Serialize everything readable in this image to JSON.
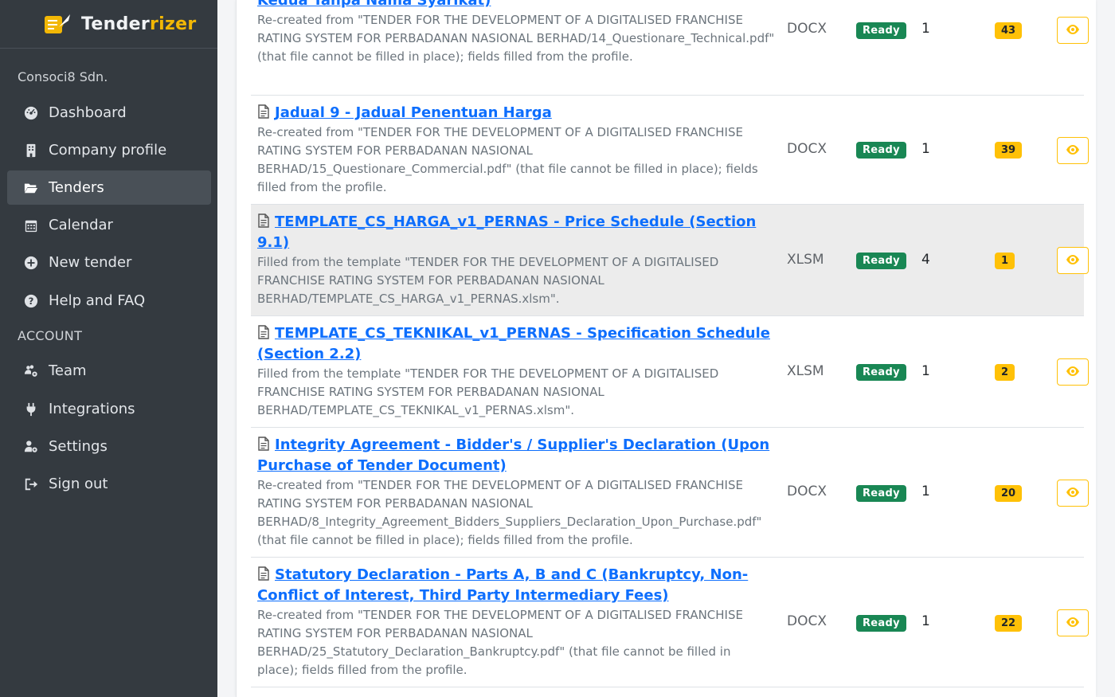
{
  "brand": {
    "name_part1": "Tender",
    "name_part2": "rizer"
  },
  "sidebar": {
    "org": "Consoci8 Sdn.",
    "items": [
      {
        "label": "Dashboard",
        "icon": "dashboard-icon"
      },
      {
        "label": "Company profile",
        "icon": "building-icon"
      },
      {
        "label": "Tenders",
        "icon": "folder-open-icon",
        "active": true
      },
      {
        "label": "Calendar",
        "icon": "calendar-icon"
      },
      {
        "label": "New tender",
        "icon": "plus-circle-icon"
      }
    ],
    "help": {
      "label": "Help and FAQ",
      "icon": "question-circle-icon"
    },
    "account_label": "ACCOUNT",
    "account_items": [
      {
        "label": "Team",
        "icon": "users-cog-icon"
      },
      {
        "label": "Integrations",
        "icon": "plug-icon"
      },
      {
        "label": "Settings",
        "icon": "user-cog-icon"
      },
      {
        "label": "Sign out",
        "icon": "sign-out-icon"
      }
    ]
  },
  "documents": [
    {
      "title": "Kedua Tanpa Nama Syarikat)",
      "description": "Re-created from \"TENDER FOR THE DEVELOPMENT OF A DIGITALISED FRANCHISE RATING SYSTEM FOR PERBADANAN NASIONAL BERHAD/14_Questionare_Technical.pdf\" (that file cannot be filled in place); fields filled from the profile.",
      "type": "DOCX",
      "status": "Ready",
      "count": "1",
      "fields": "43"
    },
    {
      "title": "Jadual 9 - Jadual Penentuan Harga",
      "description": "Re-created from \"TENDER FOR THE DEVELOPMENT OF A DIGITALISED FRANCHISE RATING SYSTEM FOR PERBADANAN NASIONAL BERHAD/15_Questionare_Commercial.pdf\" (that file cannot be filled in place); fields filled from the profile.",
      "type": "DOCX",
      "status": "Ready",
      "count": "1",
      "fields": "39"
    },
    {
      "title": "TEMPLATE_CS_HARGA_v1_PERNAS - Price Schedule (Section 9.1)",
      "description": "Filled from the template \"TENDER FOR THE DEVELOPMENT OF A DIGITALISED FRANCHISE RATING SYSTEM FOR PERBADANAN NASIONAL BERHAD/TEMPLATE_CS_HARGA_v1_PERNAS.xlsm\".",
      "type": "XLSM",
      "status": "Ready",
      "count": "4",
      "fields": "1"
    },
    {
      "title": "TEMPLATE_CS_TEKNIKAL_v1_PERNAS - Specification Schedule (Section 2.2)",
      "description": "Filled from the template \"TENDER FOR THE DEVELOPMENT OF A DIGITALISED FRANCHISE RATING SYSTEM FOR PERBADANAN NASIONAL BERHAD/TEMPLATE_CS_TEKNIKAL_v1_PERNAS.xlsm\".",
      "type": "XLSM",
      "status": "Ready",
      "count": "1",
      "fields": "2"
    },
    {
      "title": "Integrity Agreement - Bidder's / Supplier's Declaration (Upon Purchase of Tender Document)",
      "description": "Re-created from \"TENDER FOR THE DEVELOPMENT OF A DIGITALISED FRANCHISE RATING SYSTEM FOR PERBADANAN NASIONAL BERHAD/8_Integrity_Agreement_Bidders_Suppliers_Declaration_Upon_Purchase.pdf\" (that file cannot be filled in place); fields filled from the profile.",
      "type": "DOCX",
      "status": "Ready",
      "count": "1",
      "fields": "20"
    },
    {
      "title": "Statutory Declaration - Parts A, B and C (Bankruptcy, Non-Conflict of Interest, Third Party Intermediary Fees)",
      "description": "Re-created from \"TENDER FOR THE DEVELOPMENT OF A DIGITALISED FRANCHISE RATING SYSTEM FOR PERBADANAN NASIONAL BERHAD/25_Statutory_Declaration_Bankruptcy.pdf\" (that file cannot be filled in place); fields filled from the profile.",
      "type": "DOCX",
      "status": "Ready",
      "count": "1",
      "fields": "22"
    }
  ]
}
